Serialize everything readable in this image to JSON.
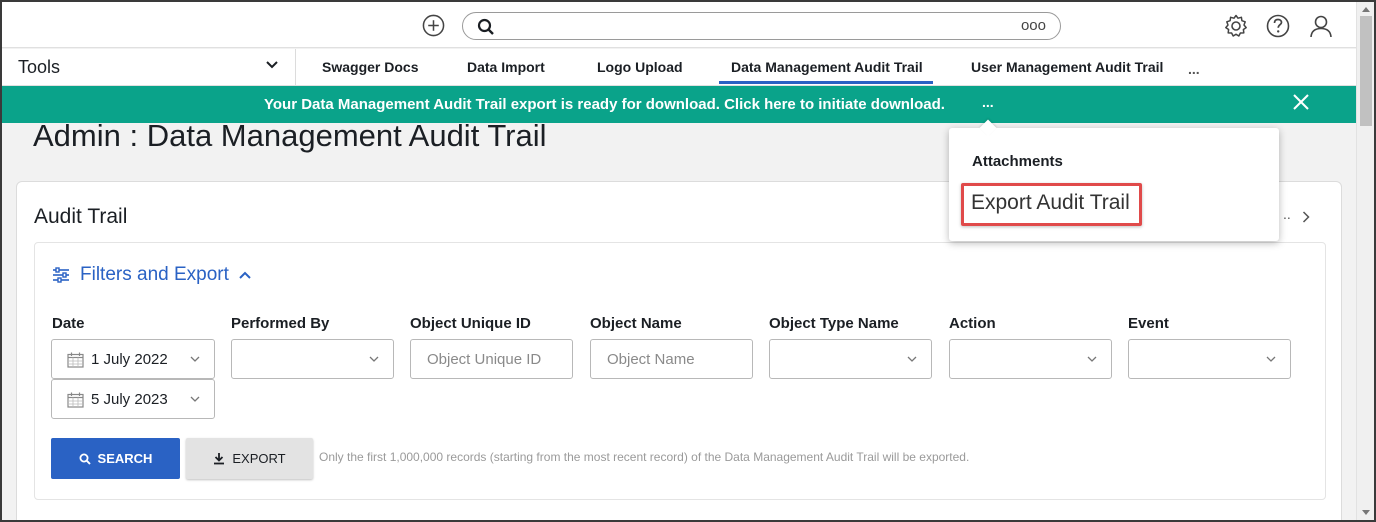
{
  "header": {
    "search_more": "ooo"
  },
  "nav": {
    "tools_label": "Tools",
    "tabs": [
      {
        "label": "Swagger Docs"
      },
      {
        "label": "Data Import"
      },
      {
        "label": "Logo Upload"
      },
      {
        "label": "Data Management Audit Trail",
        "active": true
      },
      {
        "label": "User Management Audit Trail"
      }
    ],
    "more": "..."
  },
  "banner": {
    "message": "Your Data Management Audit Trail export is ready for download. Click here to initiate download.",
    "dots": "...",
    "color": "#0aa38a"
  },
  "page": {
    "title": "Admin : Data Management Audit Trail"
  },
  "card": {
    "title": "Audit Trail",
    "right_text": ".."
  },
  "filters": {
    "heading": "Filters and Export",
    "date_label": "Date",
    "date_from": "1 July 2022",
    "date_to": "5 July 2023",
    "performed_by_label": "Performed By",
    "object_unique_id_label": "Object Unique ID",
    "object_unique_id_placeholder": "Object Unique ID",
    "object_name_label": "Object Name",
    "object_name_placeholder": "Object Name",
    "object_type_name_label": "Object Type Name",
    "action_label": "Action",
    "event_label": "Event"
  },
  "buttons": {
    "search": "SEARCH",
    "export": "EXPORT",
    "note": "Only the first 1,000,000 records (starting from the most recent record) of the Data Management Audit Trail will be exported."
  },
  "popover": {
    "heading": "Attachments",
    "item": "Export Audit Trail"
  },
  "colors": {
    "accent": "#2a62c4",
    "highlight": "#e04a4a"
  }
}
